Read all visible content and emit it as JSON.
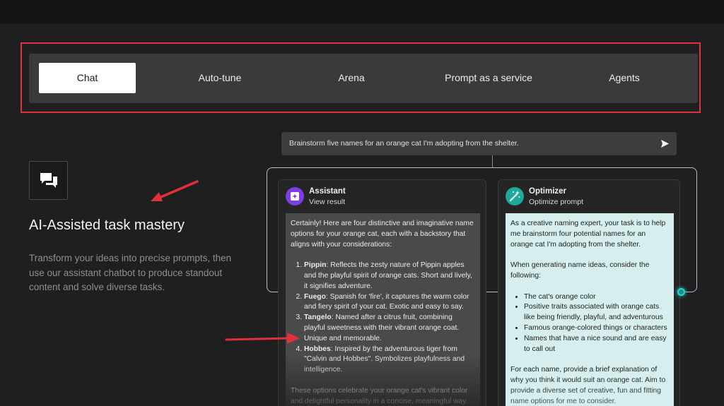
{
  "tabs": [
    {
      "label": "Chat",
      "active": true
    },
    {
      "label": "Auto-tune",
      "active": false
    },
    {
      "label": "Arena",
      "active": false
    },
    {
      "label": "Prompt as a service",
      "active": false
    },
    {
      "label": "Agents",
      "active": false
    }
  ],
  "feature": {
    "icon": "chat-bubbles-icon",
    "title": "AI-Assisted task mastery",
    "description": "Transform your ideas into precise prompts, then use our assistant chatbot to produce standout content and solve diverse tasks."
  },
  "prompt": {
    "text": "Brainstorm five names for an orange cat I'm adopting from the shelter.",
    "send_icon": "send-icon"
  },
  "assistant": {
    "title": "Assistant",
    "subtitle": "View result",
    "icon_color": "#7b3fe4",
    "intro": "Certainly! Here are four distinctive and imaginative name options for your orange cat, each with a backstory that aligns with your considerations:",
    "items": [
      {
        "name": "Pippin",
        "text": ": Reflects the zesty nature of Pippin apples and the playful spirit of orange cats. Short and lively, it signifies adventure."
      },
      {
        "name": "Fuego",
        "text": ": Spanish for 'fire', it captures the warm color and fiery spirit of your cat. Exotic and easy to say."
      },
      {
        "name": "Tangelo",
        "text": ": Named after a citrus fruit, combining playful sweetness with their vibrant orange coat. Unique and memorable."
      },
      {
        "name": "Hobbes",
        "text": ": Inspired by the adventurous tiger from \"Calvin and Hobbes\". Symbolizes playfulness and intelligence."
      }
    ],
    "outro": "These options celebrate your orange cat's vibrant color and delightful personality in a concise, meaningful way."
  },
  "optimizer": {
    "title": "Optimizer",
    "subtitle": "Optimize prompt",
    "icon_color": "#1fa99a",
    "intro": "As a creative naming expert, your task is to help me brainstorm four potential names for an orange cat I'm adopting from the shelter.",
    "lead": "When generating name ideas, consider the following:",
    "bullets": [
      "The cat's orange color",
      "Positive traits associated with orange cats like being friendly, playful, and adventurous",
      "Famous orange-colored things or characters",
      "Names that have a nice sound and are easy to call out"
    ],
    "outro": "For each name, provide a brief explanation of why you think it would suit an orange cat. Aim to provide a diverse set of creative, fun and fitting name options for me to consider."
  },
  "colors": {
    "annotation": "#e0303c",
    "accent_teal": "#2bd4c8"
  }
}
